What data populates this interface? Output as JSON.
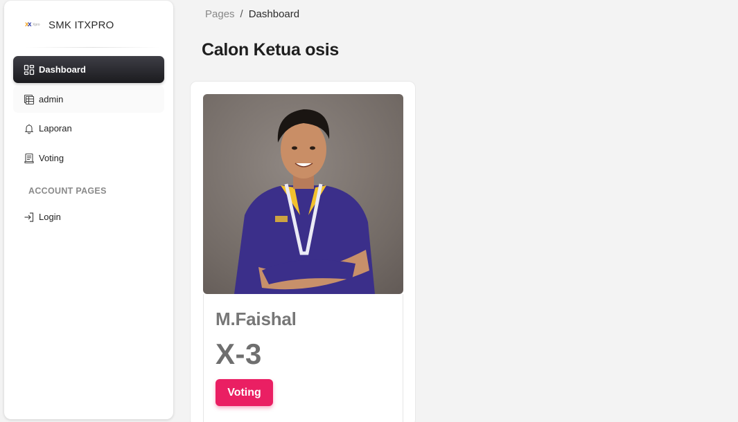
{
  "sidebar": {
    "brand": "SMK ITXPRO",
    "logo_text": "Xpro",
    "items": [
      {
        "label": "Dashboard",
        "icon": "dashboard-icon",
        "active": true
      },
      {
        "label": "admin",
        "icon": "table-icon"
      },
      {
        "label": "Laporan",
        "icon": "bell-icon"
      },
      {
        "label": "Voting",
        "icon": "receipt-icon"
      }
    ],
    "section_label": "ACCOUNT PAGES",
    "account_items": [
      {
        "label": "Login",
        "icon": "login-icon"
      }
    ]
  },
  "breadcrumb": {
    "root": "Pages",
    "separator": "/",
    "current": "Dashboard"
  },
  "page_title": "Calon Ketua osis",
  "candidate": {
    "name": "M.Faishal",
    "class": "X-3",
    "button_label": "Voting"
  },
  "colors": {
    "accent": "#ea1f63",
    "active_nav": "#1b1b1f",
    "background": "#f3f3f3"
  }
}
